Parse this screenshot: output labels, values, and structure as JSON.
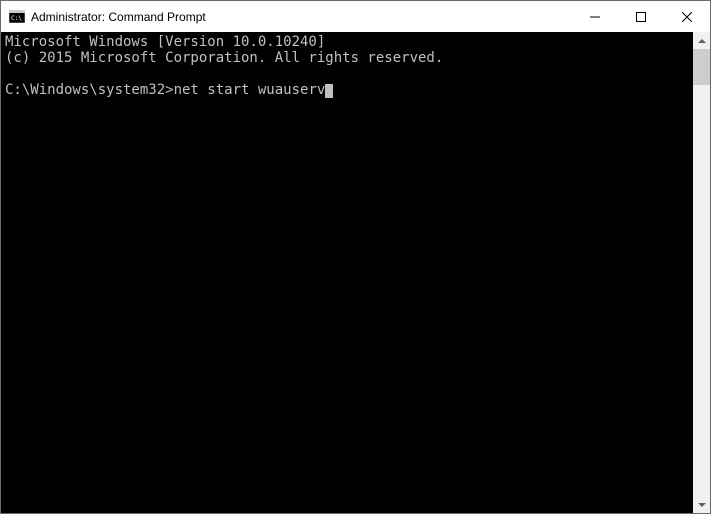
{
  "window": {
    "title": "Administrator: Command Prompt"
  },
  "terminal": {
    "line1": "Microsoft Windows [Version 10.0.10240]",
    "line2": "(c) 2015 Microsoft Corporation. All rights reserved.",
    "prompt": "C:\\Windows\\system32>",
    "command": "net start wuauserv"
  }
}
